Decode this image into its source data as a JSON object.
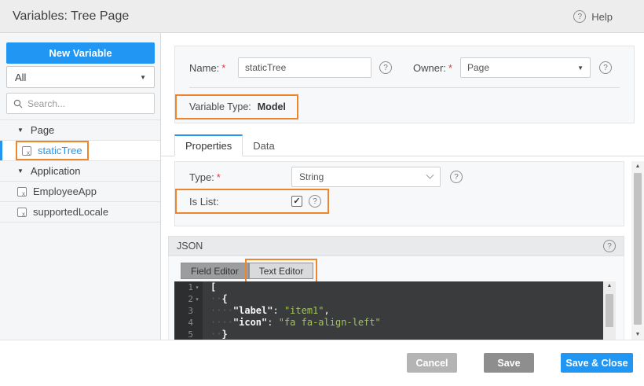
{
  "window": {
    "title": "Variables: Tree Page",
    "help_label": "Help"
  },
  "sidebar": {
    "new_variable_label": "New Variable",
    "filter_value": "All",
    "search_placeholder": "Search...",
    "tree": [
      {
        "kind": "group",
        "label": "Page",
        "expanded": true
      },
      {
        "kind": "item",
        "label": "staticTree",
        "selected": true,
        "highlighted": true
      },
      {
        "kind": "group",
        "label": "Application",
        "expanded": true
      },
      {
        "kind": "item",
        "label": "EmployeeApp"
      },
      {
        "kind": "item",
        "label": "supportedLocale"
      }
    ]
  },
  "form": {
    "required_marker": "*",
    "name_label": "Name:",
    "name_value": "staticTree",
    "owner_label": "Owner:",
    "owner_value": "Page",
    "variable_type_label": "Variable Type:",
    "variable_type_value": "Model"
  },
  "tabs": [
    {
      "label": "Properties",
      "active": true
    },
    {
      "label": "Data",
      "active": false
    }
  ],
  "properties": {
    "type_label": "Type:",
    "type_value": "String",
    "is_list_label": "Is List:",
    "is_list_checked": true
  },
  "json_section": {
    "title": "JSON",
    "editor_tabs": [
      {
        "label": "Field Editor",
        "active": false,
        "highlighted": false
      },
      {
        "label": "Text Editor",
        "active": true,
        "highlighted": true
      }
    ],
    "code_lines": [
      {
        "num": "1",
        "fold": true,
        "indent": 0,
        "segments": [
          {
            "cls": "br",
            "text": "["
          }
        ]
      },
      {
        "num": "2",
        "fold": true,
        "indent": 2,
        "segments": [
          {
            "cls": "br",
            "text": "{"
          }
        ]
      },
      {
        "num": "3",
        "fold": false,
        "indent": 4,
        "segments": [
          {
            "cls": "key",
            "text": "\"label\""
          },
          {
            "cls": "pln",
            "text": ": "
          },
          {
            "cls": "str",
            "text": "\"item1\""
          },
          {
            "cls": "pln",
            "text": ","
          }
        ]
      },
      {
        "num": "4",
        "fold": false,
        "indent": 4,
        "segments": [
          {
            "cls": "key",
            "text": "\"icon\""
          },
          {
            "cls": "pln",
            "text": ": "
          },
          {
            "cls": "str",
            "text": "\"fa fa-align-left\""
          }
        ]
      },
      {
        "num": "5",
        "fold": false,
        "indent": 2,
        "segments": [
          {
            "cls": "br",
            "text": "}"
          }
        ]
      }
    ]
  },
  "footer": {
    "buttons": [
      {
        "label": "Cancel",
        "style": "muted"
      },
      {
        "label": "Save",
        "style": "gray"
      },
      {
        "label": "Save & Close",
        "style": "primary"
      }
    ]
  },
  "icons": {
    "help_glyph": "?",
    "caret_down": "▼",
    "select_arrow": "▼",
    "fold_arrow": "▾",
    "scroll_up": "▲",
    "scroll_down": "▼",
    "check_glyph": "✓",
    "variable_glyph": "x"
  },
  "colors": {
    "accent_blue": "#2196f3",
    "highlight_orange": "#f0862b",
    "code_string_green": "#a3c25e",
    "code_background": "#3a3b3c",
    "gutter_background": "#2d2e2f"
  }
}
